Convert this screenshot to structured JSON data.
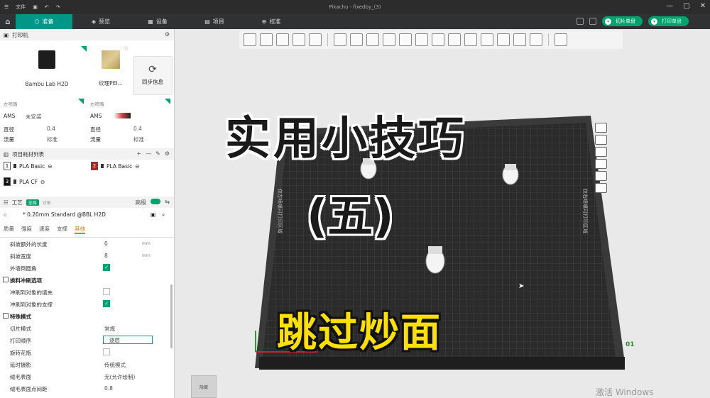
{
  "window": {
    "title": "Pikachu - fixedby_(3)",
    "menu_label": "文件"
  },
  "tabs": [
    {
      "label": "准备"
    },
    {
      "label": "预览"
    },
    {
      "label": "设备"
    },
    {
      "label": "项目"
    },
    {
      "label": "校准"
    }
  ],
  "actions": {
    "slice": "切片单盘",
    "print": "打印单盘"
  },
  "printer": {
    "section": "打印机",
    "model": "Bambu Lab H2D",
    "plate": "纹理PEI...",
    "sync": "同步信息"
  },
  "nozzles": {
    "left": {
      "caption": "左喷嘴",
      "ams": "AMS",
      "ams_value": "未安装",
      "dia": "直径",
      "dia_value": "0.4",
      "flow": "流量",
      "flow_value": "标准"
    },
    "right": {
      "caption": "右喷嘴",
      "ams": "AMS",
      "dia": "直径",
      "dia_value": "0.4",
      "flow": "流量",
      "flow_value": "标准"
    }
  },
  "filaments": {
    "section": "项目耗材列表",
    "items": [
      {
        "num": "1",
        "name": "PLA Basic",
        "color": "#ffffff"
      },
      {
        "num": "2",
        "name": "PLA Basic",
        "color": "#b5221e"
      },
      {
        "num": "3",
        "name": "PLA CF",
        "color": "#111111"
      }
    ]
  },
  "process": {
    "section": "工艺",
    "mode_on": "全局",
    "mode_off": "对象",
    "advanced": "高级",
    "preset": "* 0.20mm Standard @BBL H2D",
    "subtabs": [
      "质量",
      "强度",
      "速度",
      "支撑",
      "其他"
    ],
    "rows": [
      {
        "k": "斜坡额外的长度",
        "v": "0",
        "u": "mm"
      },
      {
        "k": "斜坡宽度",
        "v": "8",
        "u": "mm"
      }
    ],
    "outer_wall": "外墙倒圆角",
    "purge_group": "换料冲刷选项",
    "purge_infill": "冲刷到对象的填充",
    "purge_support": "冲刷到对象的支撑",
    "special_group": "特殊模式",
    "special": [
      {
        "k": "切片模式",
        "v": "常规"
      },
      {
        "k": "打印顺序",
        "v": "逐层"
      },
      {
        "k": "旋转花瓶",
        "v": ""
      },
      {
        "k": "延时摄影",
        "v": "传统模式"
      },
      {
        "k": "绒毛表面",
        "v": "无(允许绘制)"
      },
      {
        "k": "绒毛表面点间距",
        "v": "0.8"
      }
    ]
  },
  "overlay": {
    "title": "实用小技巧",
    "subtitle": "(五)",
    "tip": "跳过炒面"
  },
  "plate": {
    "left_label": "仅左喷嘴可打印区域",
    "right_label": "仅右喷嘴可打印区域",
    "number": "01"
  },
  "canvas": {
    "thumb": "隐藏",
    "watermark": "激活 Windows"
  }
}
